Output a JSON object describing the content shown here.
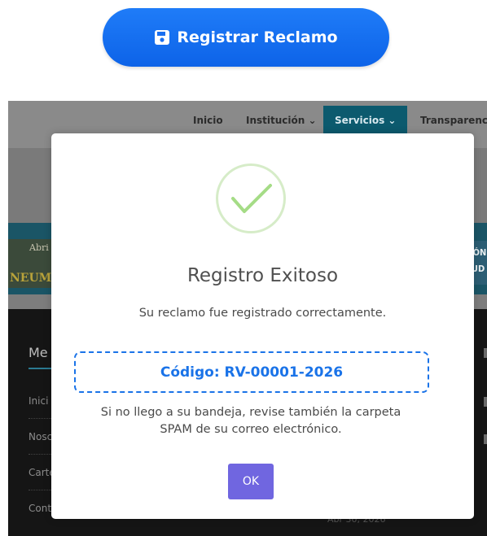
{
  "register_button": {
    "label": "Registrar Reclamo",
    "icon": "floppy-disk-icon",
    "color": "#1a6ff0"
  },
  "navbar": {
    "items": [
      {
        "label": "Inicio"
      },
      {
        "label": "Institución ⌄"
      },
      {
        "label": "Servicios ⌄",
        "active": true
      },
      {
        "label": "Transparenc"
      }
    ]
  },
  "banner": {
    "left_text_top": "Abri",
    "left_text_bottom": "NEUM",
    "right_text_top": "RECCIÓN",
    "right_text_bottom": "E SALUD"
  },
  "footer_sidebar": {
    "heading": "Me",
    "links": [
      "Inici",
      "Nosc",
      "Carte",
      "Cont"
    ],
    "date_fragment": "Abr 30, 2026"
  },
  "modal": {
    "icon": "success-check-icon",
    "title": "Registro Exitoso",
    "message": "Su reclamo fue registrado correctamente.",
    "code_text": "Código: RV-00001-2026",
    "note_line1": "Si no llego a su bandeja, revise también la carpeta",
    "note_line2": "SPAM de su correo electrónico.",
    "ok_label": "OK",
    "ok_color": "#7066e0",
    "code_color": "#1a73e8"
  }
}
